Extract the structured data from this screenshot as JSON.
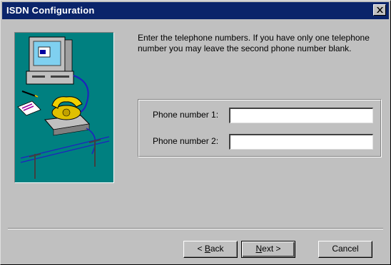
{
  "window": {
    "title": "ISDN Configuration",
    "close_label": "×"
  },
  "instructions": "Enter the telephone numbers.  If you have only one telephone number you may leave the second phone number blank.",
  "form": {
    "phone1_label": "Phone number 1:",
    "phone1_value": "",
    "phone2_label": "Phone number 2:",
    "phone2_value": ""
  },
  "buttons": {
    "back": {
      "prefix": "< ",
      "mnemonic": "B",
      "rest": "ack"
    },
    "next": {
      "mnemonic": "N",
      "rest": "ext >"
    },
    "cancel": "Cancel"
  },
  "colors": {
    "titlebar": "#0a246a",
    "dialog_bg": "#c0c0c0",
    "illustration_bg": "#008080"
  },
  "icons": {
    "illustration": "computer-and-isdn-telephone-illustration",
    "close": "close-icon"
  }
}
